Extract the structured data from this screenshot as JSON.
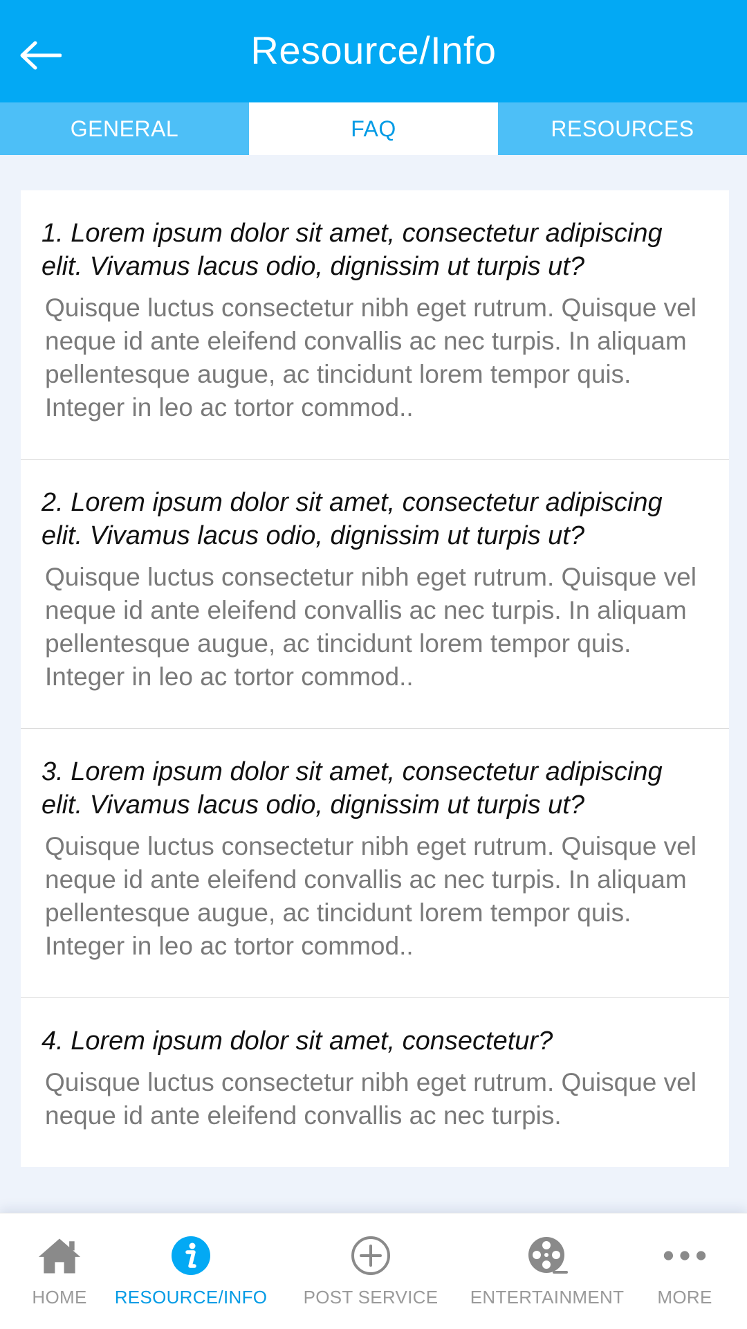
{
  "header": {
    "title": "Resource/Info",
    "back_icon": "arrow-left-icon",
    "color": "#03a9f4"
  },
  "tabs": [
    {
      "label": "GENERAL",
      "active": false
    },
    {
      "label": "FAQ",
      "active": true
    },
    {
      "label": "RESOURCES",
      "active": false
    }
  ],
  "faq": [
    {
      "question": "1. Lorem ipsum dolor sit amet, consectetur adipiscing elit. Vivamus lacus odio, dignissim ut turpis ut?",
      "answer": "Quisque luctus consectetur nibh eget rutrum. Quisque vel neque id ante eleifend convallis ac nec turpis. In aliquam pellentesque augue, ac tincidunt lorem tempor quis. Integer in leo ac tortor commod.."
    },
    {
      "question": "2. Lorem ipsum dolor sit amet, consectetur adipiscing elit. Vivamus lacus odio, dignissim ut turpis ut?",
      "answer": "Quisque luctus consectetur nibh eget rutrum. Quisque vel neque id ante eleifend convallis ac nec turpis. In aliquam pellentesque augue, ac tincidunt lorem tempor quis. Integer in leo ac tortor commod.."
    },
    {
      "question": "3. Lorem ipsum dolor sit amet, consectetur adipiscing elit. Vivamus lacus odio, dignissim ut turpis ut?",
      "answer": "Quisque luctus consectetur nibh eget rutrum. Quisque vel neque id ante eleifend convallis ac nec turpis. In aliquam pellentesque augue, ac tincidunt lorem tempor quis. Integer in leo ac tortor commod.."
    },
    {
      "question": "4. Lorem ipsum dolor sit amet, consectetur?",
      "answer": "Quisque luctus consectetur nibh eget rutrum. Quisque vel neque id ante eleifend convallis ac nec turpis."
    }
  ],
  "bottom_nav": [
    {
      "label": "HOME",
      "icon": "home-icon",
      "active": false
    },
    {
      "label": "RESOURCE/INFO",
      "icon": "info-icon",
      "active": true
    },
    {
      "label": "POST SERVICE",
      "icon": "plus-circle-icon",
      "active": false
    },
    {
      "label": "ENTERTAINMENT",
      "icon": "film-reel-icon",
      "active": false
    },
    {
      "label": "MORE",
      "icon": "more-dots-icon",
      "active": false
    }
  ],
  "colors": {
    "accent": "#03a9f4",
    "tab_bar": "#4dbff7",
    "active_text": "#039be5",
    "inactive_nav": "#9a9a9a"
  }
}
